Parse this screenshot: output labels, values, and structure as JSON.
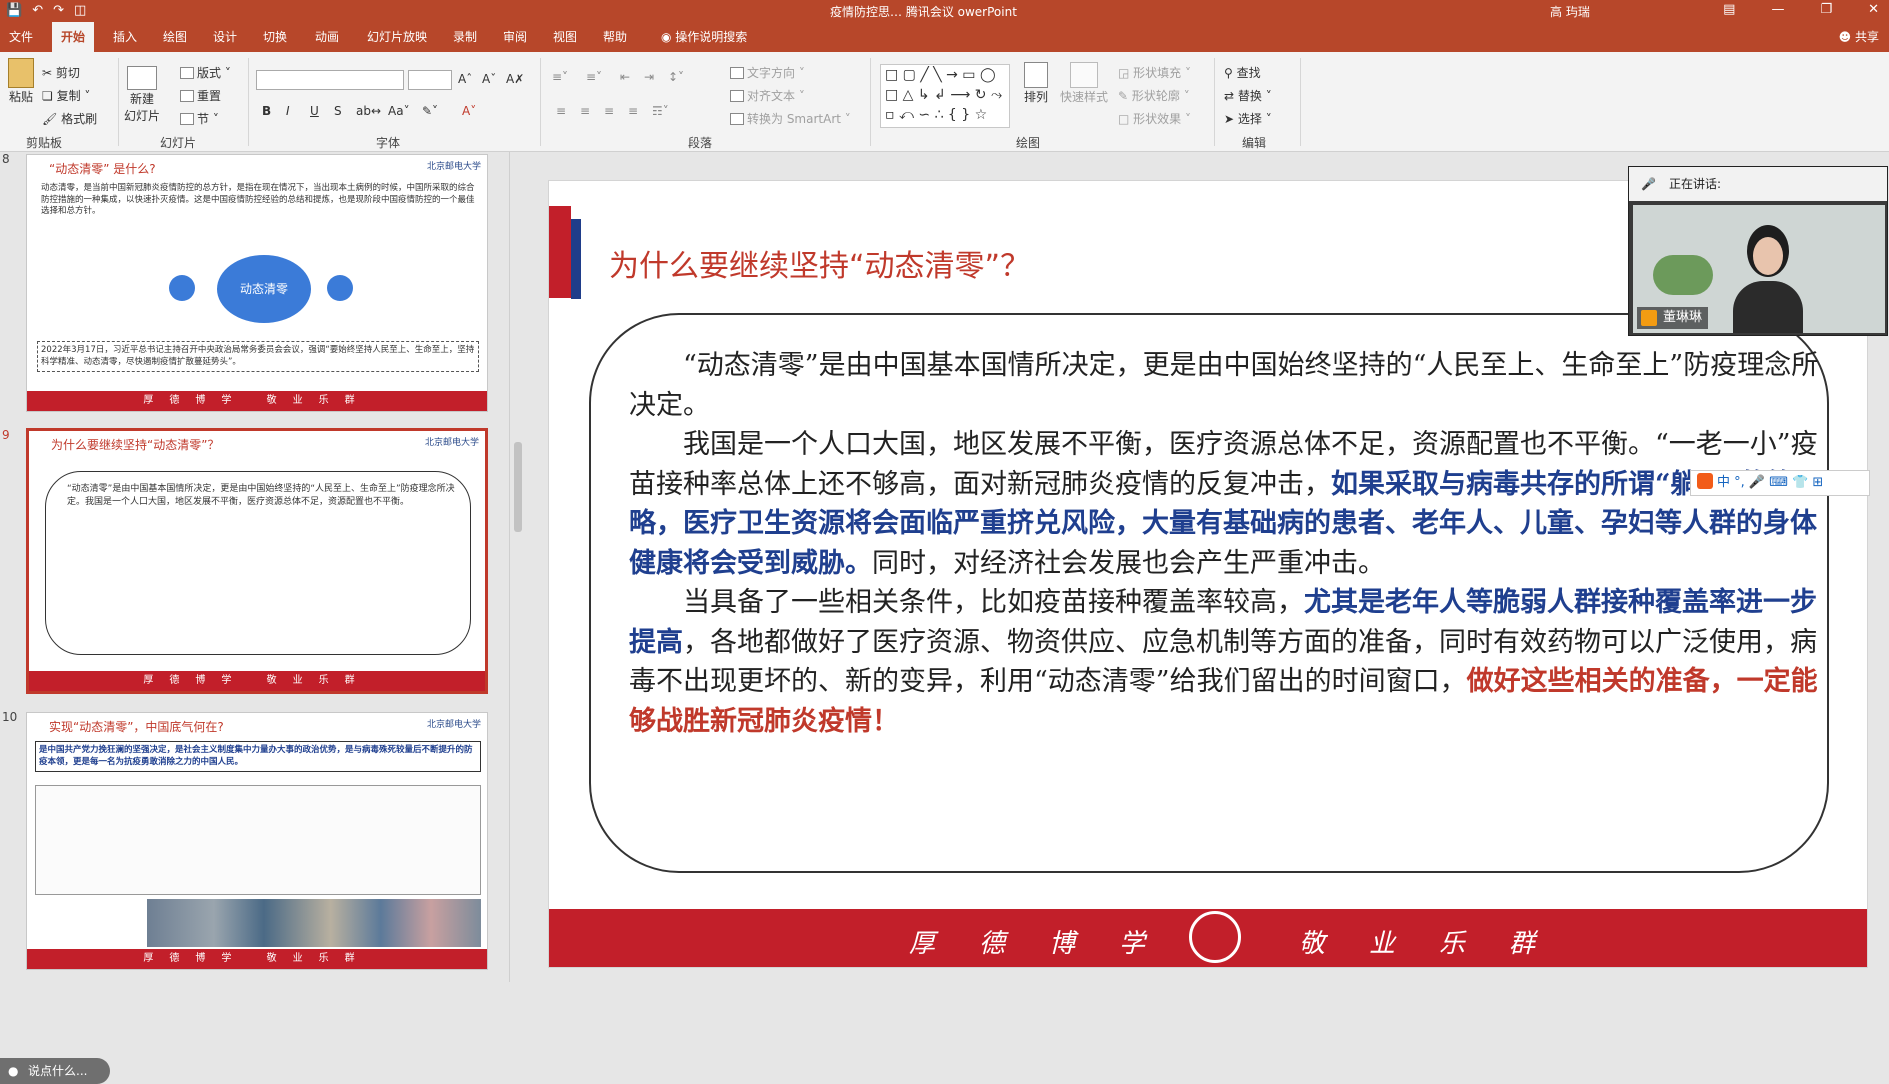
{
  "titlebar": {
    "title": "疫情防控思… 腾讯会议 owerPoint",
    "user": "高 玙瑞",
    "qa_icons": [
      "save-icon",
      "undo-icon",
      "redo-icon",
      "present-icon"
    ]
  },
  "tabs": [
    "文件",
    "开始",
    "插入",
    "绘图",
    "设计",
    "切换",
    "动画",
    "幻灯片放映",
    "录制",
    "审阅",
    "视图",
    "帮助",
    "操作说明搜索"
  ],
  "share": "共享",
  "ribbon": {
    "clipboard": {
      "paste": "粘贴",
      "cut": "剪切",
      "copy": "复制",
      "format": "格式刷",
      "label": "剪贴板"
    },
    "slides": {
      "new": "新建",
      "new2": "幻灯片",
      "layout": "版式",
      "reset": "重置",
      "section": "节",
      "label": "幻灯片"
    },
    "font": {
      "bold": "B",
      "italic": "I",
      "underline": "U",
      "strike": "S",
      "label": "字体"
    },
    "paragraph": {
      "direction": "文字方向",
      "align": "对齐文本",
      "smartart": "转换为 SmartArt",
      "label": "段落"
    },
    "drawing": {
      "arrange": "排列",
      "quick": "快速样式",
      "fill": "形状填充",
      "outline": "形状轮廓",
      "effect": "形状效果",
      "label": "绘图"
    },
    "editing": {
      "find": "查找",
      "replace": "替换",
      "select": "选择",
      "label": "编辑"
    }
  },
  "thumbnails": {
    "n8": "8",
    "n9": "9",
    "n10": "10",
    "t8_title": "“动态清零” 是什么?",
    "t8_circle": "动态清零",
    "t8_text1": "动态清零，是当前中国新冠肺炎疫情防控的总方针，是指在现在情况下，当出现本土病例的时候，中国所采取的综合防控措施的一种集成，以快速扑灭疫情。这是中国疫情防控经验的总结和提炼，也是现阶段中国疫情防控的一个最佳选择和总方针。",
    "t8_text2": "2022年3月17日，习近平总书记主持召开中央政治局常务委员会会议，强调“要始终坚持人民至上、生命至上，坚持科学精准、动态清零，尽快遏制疫情扩散蔓延势头”。",
    "t9_title": "为什么要继续坚持“动态清零”？",
    "t9_text": "“动态清零”是由中国基本国情所决定，更是由中国始终坚持的“人民至上、生命至上”防疫理念所决定。我国是一个人口大国，地区发展不平衡，医疗资源总体不足，资源配置也不平衡。",
    "t10_title": "实现“动态清零”，中国底气何在?",
    "t10_text": "是中国共产党力挽狂澜的坚强决定，是社会主义制度集中力量办大事的政治优势，是与病毒殊死较量后不断提升的防疫本领，更是每一名为抗疫勇敢消除之力的中国人民。",
    "logo": "北京邮电大学",
    "footer": "厚德博学 敬业乐群"
  },
  "slide": {
    "title": "为什么要继续坚持“动态清零”？",
    "p1": "“动态清零”是由中国基本国情所决定，更是由中国始终坚持的“人民至上、生命至上”防疫理念所决定。",
    "p2a": "我国是一个人口大国，地区发展不平衡，医疗资源总体不足，资源配置也不平衡。“一老一小”疫苗接种率总体上还不够高，面对新冠肺炎疫情的反复冲击，",
    "p2b": "如果采取与病毒共存的所谓“躺平”的策略，医疗卫生资源将会面临严重挤兑风险，大量有基础病的患者、老年人、儿童、孕妇等人群的身体健康将会受到威胁。",
    "p2c": "同时，对经济社会发展也会产生严重冲击。",
    "p3a": "当具备了一些相关条件，比如疫苗接种覆盖率较高，",
    "p3b": "尤其是老年人等脆弱人群接种覆盖率进一步提高",
    "p3c": "，各地都做好了医疗资源、物资供应、应急机制等方面的准备，同时有效药物可以广泛使用，病毒不出现更坏的、新的变异，利用“动态清零”给我们留出的时间窗口，",
    "p3d": "做好这些相关的准备，一定能够战胜新冠肺炎疫情！",
    "footer": [
      "厚",
      "德",
      "博",
      "学",
      "敬",
      "业",
      "乐",
      "群"
    ]
  },
  "meeting": {
    "speaking": "正在讲话:",
    "name": "董琳琳"
  },
  "ime": "中 °, 🎤 ⌨ 👕 ⊞",
  "tellme": "说点什么..."
}
